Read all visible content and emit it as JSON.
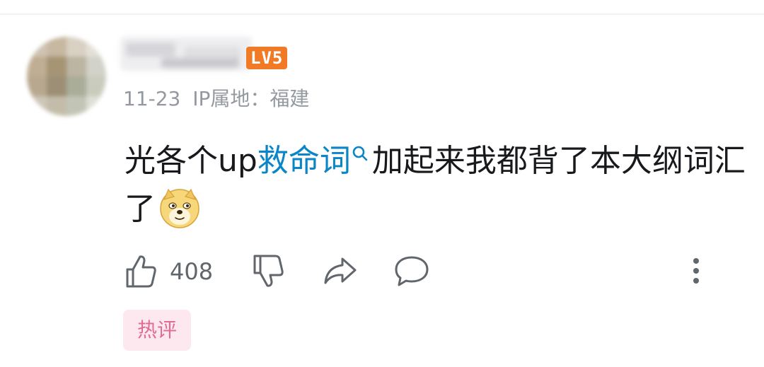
{
  "comment": {
    "level_badge": "LV5",
    "date": "11-23",
    "ip_location": "IP属地：福建",
    "text_before": "光各个up",
    "keyword_link": "救命词",
    "text_after": "加起来我都背了本大纲词汇了",
    "emoji_icon": "doge-emoji-icon",
    "like_count": "408",
    "tag": "热评"
  },
  "colors": {
    "keyword": "#0a86c8",
    "level_badge_bg": "#f07a26",
    "meta_text": "#9499a0",
    "tag_bg": "#fde8ef",
    "tag_text": "#e06c92"
  },
  "icons": [
    "search-icon",
    "thumbs-up-icon",
    "thumbs-down-icon",
    "share-icon",
    "reply-icon",
    "more-vertical-icon"
  ]
}
